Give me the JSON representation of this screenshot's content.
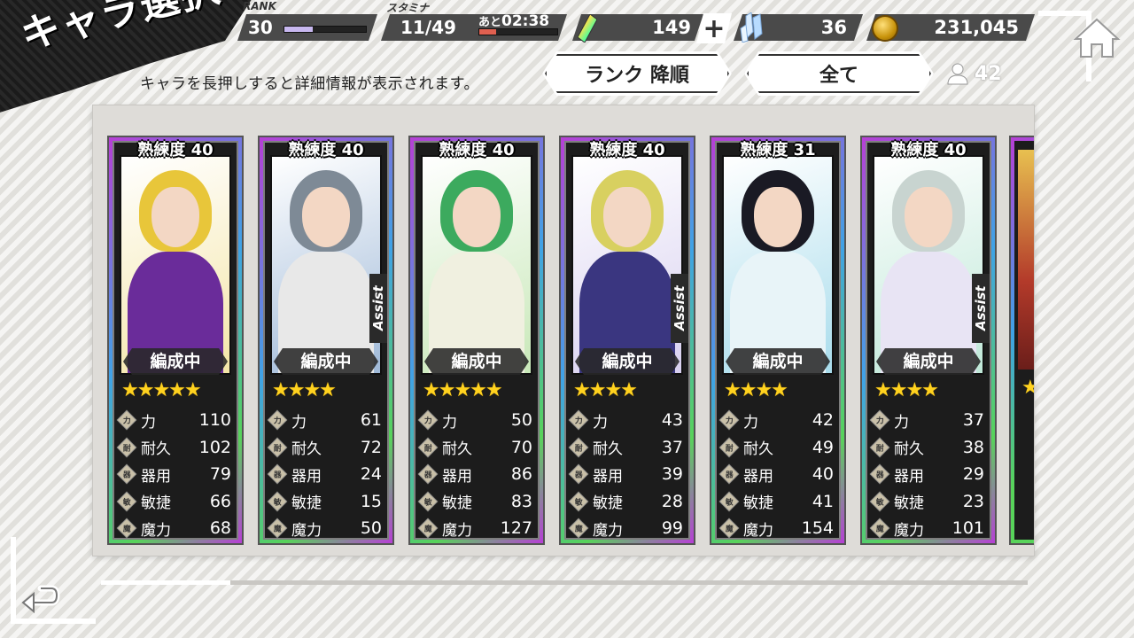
{
  "header": {
    "title": "キャラ選択",
    "hint": "キャラを長押しすると詳細情報が表示されます。",
    "rank_label": "RANK",
    "rank_value": "30",
    "rank_progress": 0.35,
    "stamina_label": "スタミナ",
    "stamina_value": "11/49",
    "stamina_progress": 0.22,
    "stamina_timer_prefix": "あと",
    "stamina_timer": "02:38",
    "gems": "149",
    "crystals": "36",
    "coins": "231,045",
    "colors": {
      "rank_bar": "#c8b8f0",
      "stamina_bar": "#e06050",
      "star": "#ffd21f"
    }
  },
  "sort": {
    "order_label": "ランク 降順",
    "filter_label": "全て",
    "count": "42"
  },
  "characters": [
    {
      "mastery": "熟練度 40",
      "assist": "",
      "formation": "編成中",
      "stars": "★★★★★",
      "stats": [
        {
          "icon": "力",
          "name": "力",
          "value": "110"
        },
        {
          "icon": "耐",
          "name": "耐久",
          "value": "102"
        },
        {
          "icon": "器",
          "name": "器用",
          "value": "79"
        },
        {
          "icon": "敏",
          "name": "敏捷",
          "value": "66"
        },
        {
          "icon": "魔",
          "name": "魔力",
          "value": "68"
        }
      ],
      "colors": {
        "bg": "#f4e6a8",
        "hair": "#e8c63a",
        "body": "#6a2c9a"
      }
    },
    {
      "mastery": "熟練度 40",
      "assist": "Assist",
      "formation": "編成中",
      "stars": "★★★★",
      "stats": [
        {
          "icon": "力",
          "name": "力",
          "value": "61"
        },
        {
          "icon": "耐",
          "name": "耐久",
          "value": "72"
        },
        {
          "icon": "器",
          "name": "器用",
          "value": "24"
        },
        {
          "icon": "敏",
          "name": "敏捷",
          "value": "15"
        },
        {
          "icon": "魔",
          "name": "魔力",
          "value": "50"
        }
      ],
      "colors": {
        "bg": "#9fb9d8",
        "hair": "#7e8a96",
        "body": "#e8e8e8"
      }
    },
    {
      "mastery": "熟練度 40",
      "assist": "",
      "formation": "編成中",
      "stars": "★★★★★",
      "stats": [
        {
          "icon": "力",
          "name": "力",
          "value": "50"
        },
        {
          "icon": "耐",
          "name": "耐久",
          "value": "70"
        },
        {
          "icon": "器",
          "name": "器用",
          "value": "86"
        },
        {
          "icon": "敏",
          "name": "敏捷",
          "value": "83"
        },
        {
          "icon": "魔",
          "name": "魔力",
          "value": "127"
        }
      ],
      "colors": {
        "bg": "#c8e8b8",
        "hair": "#3caa5e",
        "body": "#f0f0e0"
      }
    },
    {
      "mastery": "熟練度 40",
      "assist": "Assist",
      "formation": "編成中",
      "stars": "★★★★",
      "stats": [
        {
          "icon": "力",
          "name": "力",
          "value": "43"
        },
        {
          "icon": "耐",
          "name": "耐久",
          "value": "37"
        },
        {
          "icon": "器",
          "name": "器用",
          "value": "39"
        },
        {
          "icon": "敏",
          "name": "敏捷",
          "value": "28"
        },
        {
          "icon": "魔",
          "name": "魔力",
          "value": "99"
        }
      ],
      "colors": {
        "bg": "#d8d0f0",
        "hair": "#d8d060",
        "body": "#3a3680"
      }
    },
    {
      "mastery": "熟練度 31",
      "assist": "",
      "formation": "編成中",
      "stars": "★★★★",
      "stats": [
        {
          "icon": "力",
          "name": "力",
          "value": "42"
        },
        {
          "icon": "耐",
          "name": "耐久",
          "value": "49"
        },
        {
          "icon": "器",
          "name": "器用",
          "value": "40"
        },
        {
          "icon": "敏",
          "name": "敏捷",
          "value": "41"
        },
        {
          "icon": "魔",
          "name": "魔力",
          "value": "154"
        }
      ],
      "colors": {
        "bg": "#a8dcec",
        "hair": "#1a1a24",
        "body": "#e8f4f8"
      }
    },
    {
      "mastery": "熟練度 40",
      "assist": "Assist",
      "formation": "編成中",
      "stars": "★★★★",
      "stats": [
        {
          "icon": "力",
          "name": "力",
          "value": "37"
        },
        {
          "icon": "耐",
          "name": "耐久",
          "value": "38"
        },
        {
          "icon": "器",
          "name": "器用",
          "value": "29"
        },
        {
          "icon": "敏",
          "name": "敏捷",
          "value": "23"
        },
        {
          "icon": "魔",
          "name": "魔力",
          "value": "101"
        }
      ],
      "colors": {
        "bg": "#bfe8d8",
        "hair": "#c8d4d0",
        "body": "#e8e4f4"
      }
    }
  ],
  "partial_card_stars": "★",
  "scroll_progress": 0.14
}
